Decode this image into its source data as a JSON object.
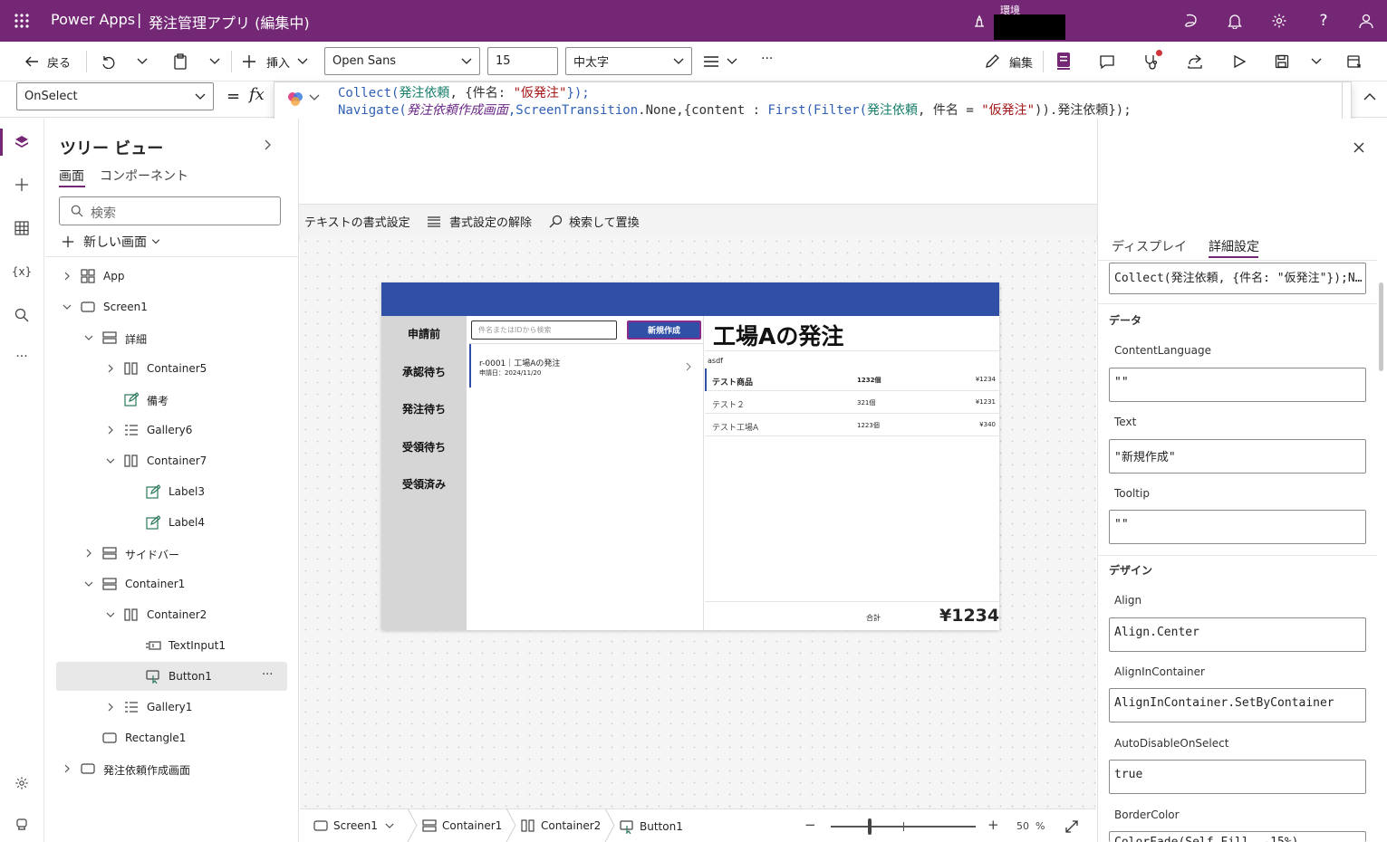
{
  "app": {
    "product": "Power Apps",
    "sep": "|",
    "title": "発注管理アプリ (編集中)",
    "env_label": "環境"
  },
  "toolbar": {
    "back": "戻る",
    "insert": "挿入",
    "font": "Open Sans",
    "size": "15",
    "weight": "中太字",
    "more": "···",
    "edit": "編集"
  },
  "formula": {
    "property": "OnSelect",
    "eq": "=",
    "fx": "fx",
    "line1": [
      [
        "Collect(",
        "#2f5fb3"
      ],
      [
        "発注依頼",
        "#167e6b"
      ],
      [
        ", {件名: ",
        "#333"
      ],
      [
        "\"仮発注\"",
        "#a31515"
      ],
      [
        "});",
        "#2f5fb3"
      ]
    ],
    "line2": [
      [
        "Navigate(",
        "#2f5fb3"
      ],
      [
        "発注依頼作成画面",
        "#6b2a86"
      ],
      [
        ",ScreenTransition",
        "#2f5fb3"
      ],
      [
        ".None,{content : ",
        "#333"
      ],
      [
        "First(Filter(",
        "#2f5fb3"
      ],
      [
        "発注依頼",
        "#167e6b"
      ],
      [
        ", 件名 = ",
        "#333"
      ],
      [
        "\"仮発注\"",
        "#a31515"
      ],
      [
        ")).発注依頼});",
        "#333"
      ]
    ],
    "fmt_text": "テキストの書式設定",
    "fmt_clear": "書式設定の解除",
    "find_replace": "検索して置換"
  },
  "tree": {
    "title": "ツリー ビュー",
    "tab_screens": "画面",
    "tab_components": "コンポーネント",
    "search_placeholder": "検索",
    "new_screen": "新しい画面",
    "items": [
      {
        "label": "App",
        "indent": 0,
        "chev": "right",
        "icon": "app"
      },
      {
        "label": "Screen1",
        "indent": 0,
        "chev": "down",
        "icon": "screen"
      },
      {
        "label": "詳細",
        "indent": 1,
        "chev": "down",
        "icon": "hstack"
      },
      {
        "label": "Container5",
        "indent": 2,
        "chev": "right",
        "icon": "vstack"
      },
      {
        "label": "備考",
        "indent": 2,
        "chev": "",
        "icon": "edit"
      },
      {
        "label": "Gallery6",
        "indent": 2,
        "chev": "right",
        "icon": "gallery"
      },
      {
        "label": "Container7",
        "indent": 2,
        "chev": "down",
        "icon": "vstack"
      },
      {
        "label": "Label3",
        "indent": 3,
        "chev": "",
        "icon": "edit"
      },
      {
        "label": "Label4",
        "indent": 3,
        "chev": "",
        "icon": "edit"
      },
      {
        "label": "サイドバー",
        "indent": 1,
        "chev": "right",
        "icon": "hstack"
      },
      {
        "label": "Container1",
        "indent": 1,
        "chev": "down",
        "icon": "hstack"
      },
      {
        "label": "Container2",
        "indent": 2,
        "chev": "down",
        "icon": "vstack"
      },
      {
        "label": "TextInput1",
        "indent": 3,
        "chev": "",
        "icon": "textinput"
      },
      {
        "label": "Button1",
        "indent": 3,
        "chev": "",
        "icon": "button",
        "selected": true
      },
      {
        "label": "Gallery1",
        "indent": 2,
        "chev": "right",
        "icon": "gallery"
      },
      {
        "label": "Rectangle1",
        "indent": 1,
        "chev": "",
        "icon": "screen"
      },
      {
        "label": "発注依頼作成画面",
        "indent": 0,
        "chev": "right",
        "icon": "screen"
      }
    ]
  },
  "canvas": {
    "nav": [
      "申請前",
      "承認待ち",
      "発注待ち",
      "受領待ち",
      "受領済み"
    ],
    "search_placeholder": "件名またはIDから検索",
    "new_button": "新規作成",
    "list_item": {
      "title": "r-0001｜工場Aの発注",
      "date": "申請日：2024/11/20"
    },
    "detail_title": "工場Aの発注",
    "note": "asdf",
    "rows": [
      {
        "name": "テスト商品",
        "qty": "1232個",
        "price": "¥1234"
      },
      {
        "name": "テスト２",
        "qty": "321個",
        "price": "¥1231"
      },
      {
        "name": "テスト工場A",
        "qty": "1223個",
        "price": "¥340"
      }
    ],
    "total_label": "合計",
    "total": "¥1234",
    "header_color": "#3050a8"
  },
  "props": {
    "tab_display": "ディスプレイ",
    "tab_advanced": "詳細設定",
    "onselect_value": "Collect(発注依頼, {件名: \"仮発注\"});N…",
    "sec_data": "データ",
    "sec_design": "デザイン",
    "fields": [
      {
        "label": "ContentLanguage",
        "value": "\"\""
      },
      {
        "label": "Text",
        "value": "\"新規作成\""
      },
      {
        "label": "Tooltip",
        "value": "\"\""
      },
      {
        "label": "Align",
        "value": "Align.Center"
      },
      {
        "label": "AlignInContainer",
        "value": "AlignInContainer.SetByContainer"
      },
      {
        "label": "AutoDisableOnSelect",
        "value": "true"
      },
      {
        "label": "BorderColor",
        "value": "ColorFade(Self.Fill, -15%)"
      }
    ]
  },
  "breadcrumb": [
    "Screen1",
    "Container1",
    "Container2",
    "Button1"
  ],
  "zoom": {
    "value": "50",
    "unit": "%",
    "minus": "−",
    "plus": "+",
    "slider_fraction": 0.27
  }
}
